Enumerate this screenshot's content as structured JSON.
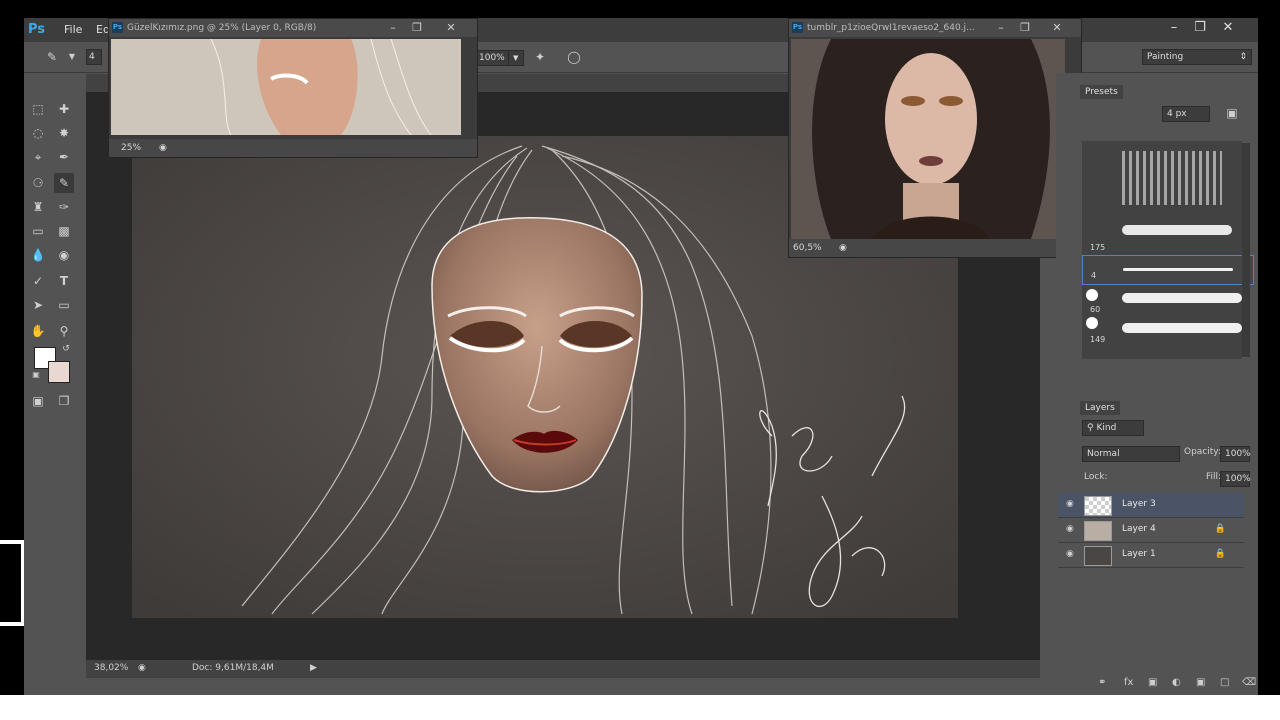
{
  "app": {
    "logo": "Ps",
    "menus": [
      "File",
      "Ed"
    ]
  },
  "options": {
    "brush_size": "4",
    "flow": "100%",
    "workspace": "Painting"
  },
  "main_doc": {
    "zoom": "38,02%",
    "doc_info": "Doc: 9,61M/18,4M"
  },
  "float_windows": [
    {
      "title": "GüzelKızımız.png @ 25% (Layer 0, RGB/8)",
      "zoom": "25%"
    },
    {
      "title": "tumblr_p1zioeQrwI1revaeso2_640.j...",
      "zoom": "60,5%"
    }
  ],
  "brush_presets": {
    "tab": "Presets",
    "size": "4 px",
    "items": [
      {
        "num": "175"
      },
      {
        "num": "4"
      },
      {
        "num": "60"
      },
      {
        "num": "149"
      }
    ]
  },
  "layers": {
    "tab": "Layers",
    "filter": "Kind",
    "blend": "Normal",
    "opacity_label": "Opacity:",
    "opacity": "100%",
    "lock_label": "Lock:",
    "fill_label": "Fill:",
    "fill": "100%",
    "rows": [
      {
        "name": "Layer 3",
        "selected": true
      },
      {
        "name": "Layer 4",
        "selected": false
      },
      {
        "name": "Layer 1",
        "selected": false
      }
    ]
  },
  "signature": "Gözde"
}
